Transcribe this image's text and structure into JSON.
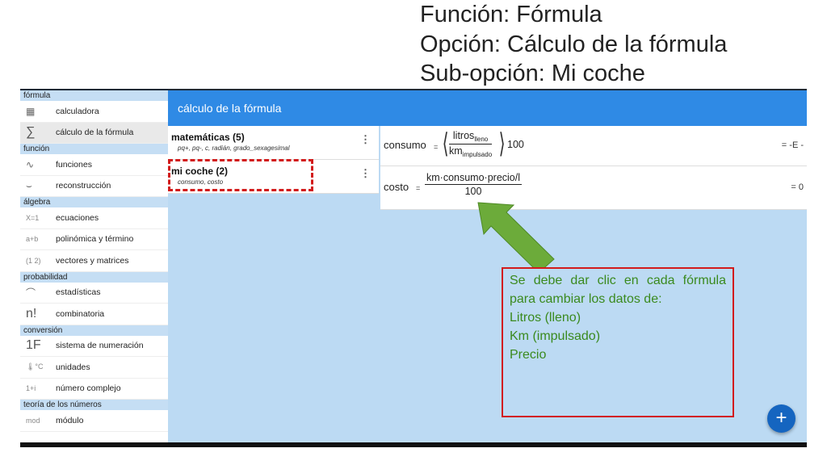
{
  "slide_title": {
    "line1": "Función: Fórmula",
    "line2": "Opción: Cálculo de la fórmula",
    "line3": "Sub-opción: Mi coche"
  },
  "sidebar": {
    "sections": [
      {
        "title": "fórmula",
        "items": [
          {
            "icon": "calculator-icon",
            "glyph": "▦",
            "label": "calculadora",
            "active": false
          },
          {
            "icon": "sigma-icon",
            "glyph": "∑",
            "label": "cálculo de la fórmula",
            "active": true
          }
        ]
      },
      {
        "title": "función",
        "items": [
          {
            "icon": "wave-icon",
            "glyph": "∿",
            "label": "funciones",
            "active": false
          },
          {
            "icon": "curve-icon",
            "glyph": "⌣",
            "label": "reconstrucción",
            "active": false
          }
        ]
      },
      {
        "title": "álgebra",
        "items": [
          {
            "icon": "equation-icon",
            "glyph": "X=1",
            "label": "ecuaciones",
            "active": false
          },
          {
            "icon": "polynomial-icon",
            "glyph": "a+b",
            "label": "polinómica y término",
            "active": false
          },
          {
            "icon": "matrix-icon",
            "glyph": "(1 2)",
            "label": "vectores y matrices",
            "active": false
          }
        ]
      },
      {
        "title": "probabilidad",
        "items": [
          {
            "icon": "statistics-icon",
            "glyph": "⌒",
            "label": "estadísticas",
            "active": false
          },
          {
            "icon": "factorial-icon",
            "glyph": "n!",
            "label": "combinatoria",
            "active": false
          }
        ]
      },
      {
        "title": "conversión",
        "items": [
          {
            "icon": "hex-icon",
            "glyph": "1F",
            "label": "sistema de numeración",
            "active": false
          },
          {
            "icon": "thermometer-icon",
            "glyph": "🌡°C",
            "label": "unidades",
            "active": false
          },
          {
            "icon": "complex-icon",
            "glyph": "1+i",
            "label": "número complejo",
            "active": false
          }
        ]
      },
      {
        "title": "teoría de los números",
        "items": [
          {
            "icon": "mod-icon",
            "glyph": "mod",
            "label": "módulo",
            "active": false
          }
        ]
      }
    ]
  },
  "topbar": {
    "title": "cálculo de la fórmula"
  },
  "formula_list": [
    {
      "name": "matemáticas (5)",
      "sub": "pq+, pq-, c, radián, grado_sexagesimal",
      "menu": "⋮"
    },
    {
      "name": "mi coche (2)",
      "sub": "consumo, costo",
      "menu": "⋮"
    }
  ],
  "formulas": {
    "consumo": {
      "label": "consumo",
      "eq": "=",
      "num": "litros",
      "num_sub": "lleno",
      "den": "km",
      "den_sub": "impulsado",
      "factor": "100",
      "result": "= -E -"
    },
    "costo": {
      "label": "costo",
      "eq": "=",
      "num": "km·consumo·precio/l",
      "den": "100",
      "result": "= 0"
    }
  },
  "note": {
    "line1": "Se debe dar clic en cada fórmula",
    "line2": "para cambiar los datos de:",
    "line3": "Litros (lleno)",
    "line4": "Km (impulsado)",
    "line5": "Precio"
  },
  "fab": {
    "label": "+"
  },
  "colors": {
    "topbar": "#2f8ae5",
    "section_header": "#c5def4",
    "background": "#bcdaf3",
    "highlight": "#d21b1b",
    "note_text": "#3a8a1e",
    "arrow": "#6cab3a",
    "fab": "#1565c0"
  }
}
